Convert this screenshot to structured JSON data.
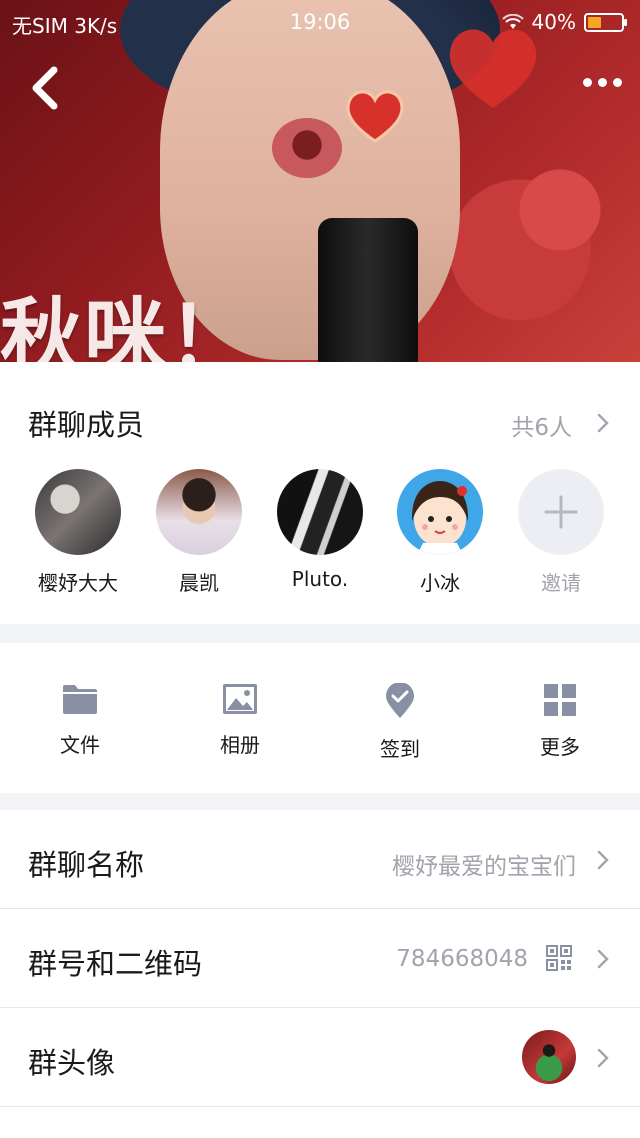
{
  "status_bar": {
    "carrier": "无SIM",
    "speed": "3K/s",
    "time": "19:06",
    "battery_percent": "40%",
    "battery_level": 0.4,
    "battery_color": "#f5a623"
  },
  "header": {
    "back_icon": "back-chevron-icon",
    "more_icon": "more-dots-icon",
    "cover_caption": "秋咪！"
  },
  "members": {
    "title": "群聊成员",
    "count_label": "共6人",
    "list": [
      {
        "name": "樱妤大大"
      },
      {
        "name": "晨凯"
      },
      {
        "name": "Pluto."
      },
      {
        "name": "小冰"
      }
    ],
    "invite_label": "邀请"
  },
  "tools": {
    "items": [
      {
        "label": "文件",
        "icon": "folder-icon"
      },
      {
        "label": "相册",
        "icon": "image-icon"
      },
      {
        "label": "签到",
        "icon": "checkin-pin-icon"
      },
      {
        "label": "更多",
        "icon": "grid-icon"
      }
    ]
  },
  "settings": {
    "group_name": {
      "label": "群聊名称",
      "value": "樱妤最爱的宝宝们"
    },
    "group_number": {
      "label": "群号和二维码",
      "value": "784668048"
    },
    "group_avatar": {
      "label": "群头像"
    }
  },
  "colors": {
    "accent_gray": "#a1a4ac",
    "icon_gray": "#8a90a3",
    "divider": "#e6e7eb"
  }
}
